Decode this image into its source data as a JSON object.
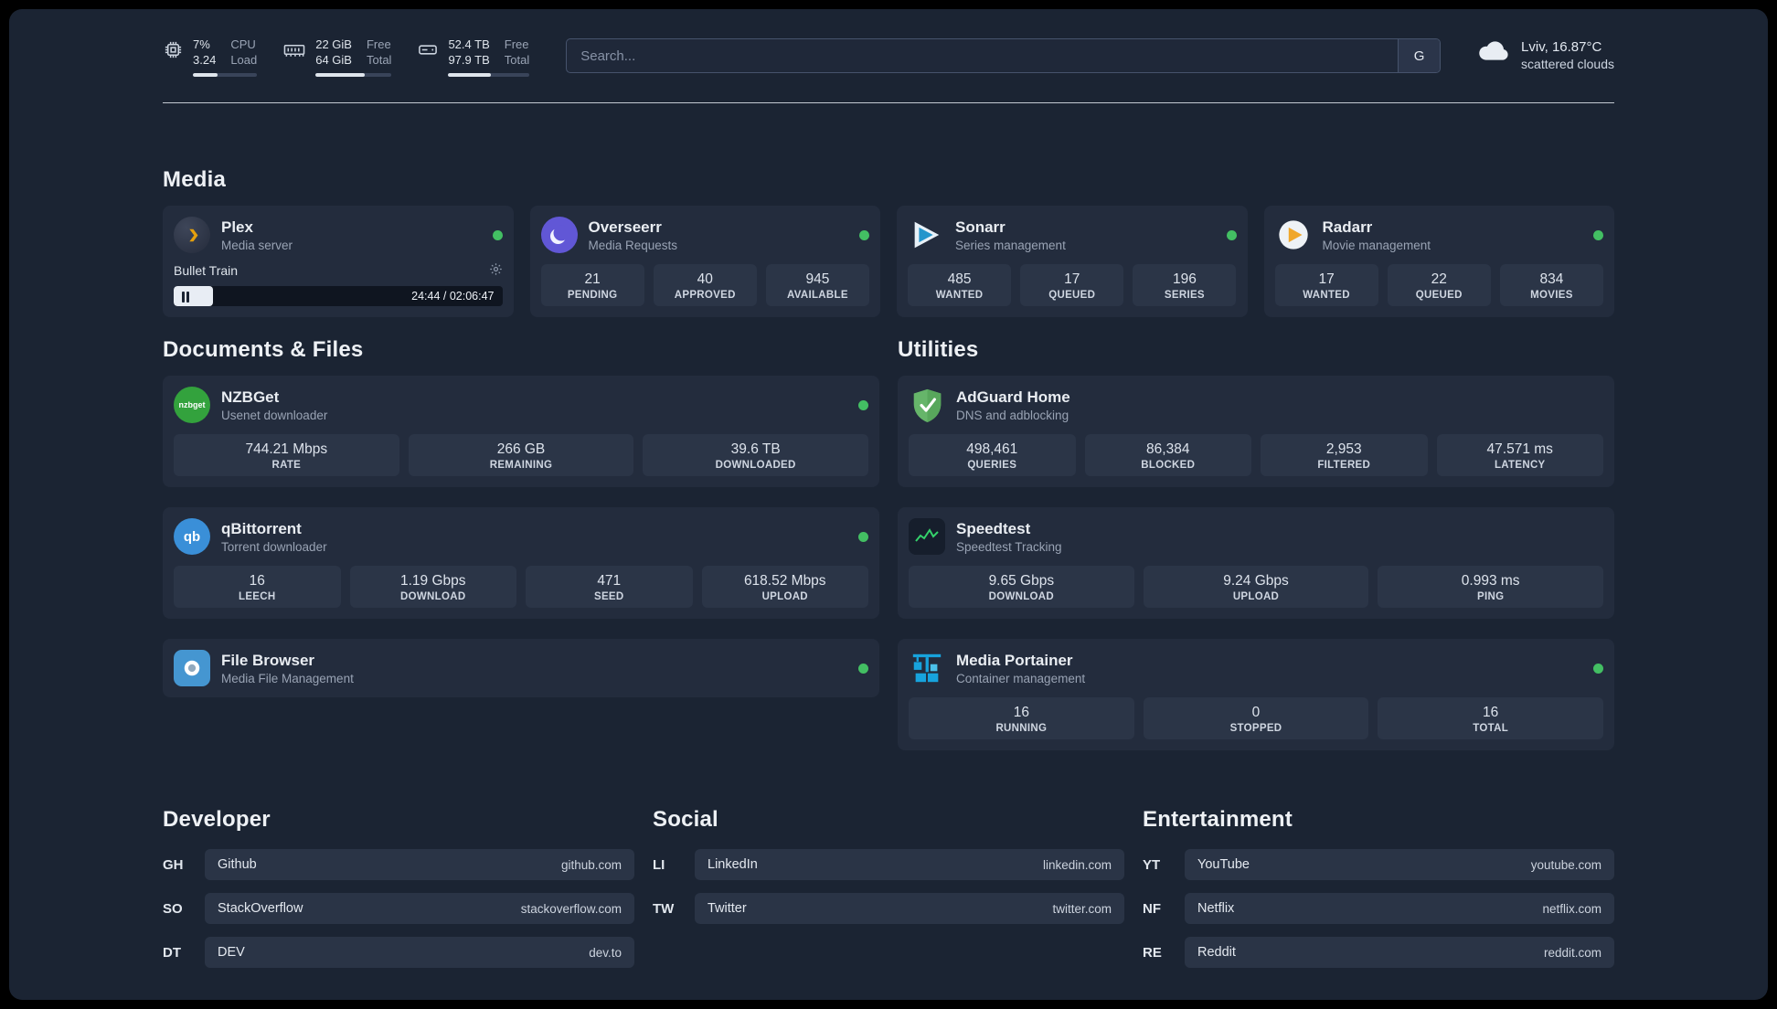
{
  "topbar": {
    "cpu": {
      "values": [
        "7%",
        "3.24"
      ],
      "labels": [
        "CPU",
        "Load"
      ],
      "progress_pct": 38
    },
    "ram": {
      "values": [
        "22 GiB",
        "64 GiB"
      ],
      "labels": [
        "Free",
        "Total"
      ],
      "progress_pct": 65
    },
    "disk": {
      "values": [
        "52.4 TB",
        "97.9 TB"
      ],
      "labels": [
        "Free",
        "Total"
      ],
      "progress_pct": 53
    },
    "search": {
      "placeholder": "Search...",
      "button_label": "G"
    },
    "weather": {
      "location": "Lviv, 16.87°C",
      "condition": "scattered clouds"
    }
  },
  "sections": {
    "media": {
      "title": "Media",
      "cards": [
        {
          "name": "Plex",
          "subtitle": "Media server",
          "status": "online",
          "now_playing": {
            "title": "Bullet Train",
            "time": "24:44 / 02:06:47",
            "progress_pct": 12
          }
        },
        {
          "name": "Overseerr",
          "subtitle": "Media Requests",
          "status": "online",
          "stats": [
            {
              "value": "21",
              "label": "PENDING"
            },
            {
              "value": "40",
              "label": "APPROVED"
            },
            {
              "value": "945",
              "label": "AVAILABLE"
            }
          ]
        },
        {
          "name": "Sonarr",
          "subtitle": "Series management",
          "status": "online",
          "stats": [
            {
              "value": "485",
              "label": "WANTED"
            },
            {
              "value": "17",
              "label": "QUEUED"
            },
            {
              "value": "196",
              "label": "SERIES"
            }
          ]
        },
        {
          "name": "Radarr",
          "subtitle": "Movie management",
          "status": "online",
          "stats": [
            {
              "value": "17",
              "label": "WANTED"
            },
            {
              "value": "22",
              "label": "QUEUED"
            },
            {
              "value": "834",
              "label": "MOVIES"
            }
          ]
        }
      ]
    },
    "documents": {
      "title": "Documents & Files",
      "cards": [
        {
          "name": "NZBGet",
          "subtitle": "Usenet downloader",
          "status": "online",
          "icon_text": "nzbget",
          "stats": [
            {
              "value": "744.21 Mbps",
              "label": "RATE"
            },
            {
              "value": "266 GB",
              "label": "REMAINING"
            },
            {
              "value": "39.6 TB",
              "label": "DOWNLOADED"
            }
          ]
        },
        {
          "name": "qBittorrent",
          "subtitle": "Torrent downloader",
          "status": "online",
          "icon_text": "qb",
          "stats": [
            {
              "value": "16",
              "label": "LEECH"
            },
            {
              "value": "1.19 Gbps",
              "label": "DOWNLOAD"
            },
            {
              "value": "471",
              "label": "SEED"
            },
            {
              "value": "618.52 Mbps",
              "label": "UPLOAD"
            }
          ]
        },
        {
          "name": "File Browser",
          "subtitle": "Media File Management",
          "status": "online"
        }
      ]
    },
    "utilities": {
      "title": "Utilities",
      "cards": [
        {
          "name": "AdGuard Home",
          "subtitle": "DNS and adblocking",
          "stats": [
            {
              "value": "498,461",
              "label": "QUERIES"
            },
            {
              "value": "86,384",
              "label": "BLOCKED"
            },
            {
              "value": "2,953",
              "label": "FILTERED"
            },
            {
              "value": "47.571 ms",
              "label": "LATENCY"
            }
          ]
        },
        {
          "name": "Speedtest",
          "subtitle": "Speedtest Tracking",
          "stats": [
            {
              "value": "9.65 Gbps",
              "label": "DOWNLOAD"
            },
            {
              "value": "9.24 Gbps",
              "label": "UPLOAD"
            },
            {
              "value": "0.993 ms",
              "label": "PING"
            }
          ]
        },
        {
          "name": "Media Portainer",
          "subtitle": "Container management",
          "status": "online",
          "stats": [
            {
              "value": "16",
              "label": "RUNNING"
            },
            {
              "value": "0",
              "label": "STOPPED"
            },
            {
              "value": "16",
              "label": "TOTAL"
            }
          ]
        }
      ]
    },
    "bookmarks": [
      {
        "title": "Developer",
        "items": [
          {
            "abbr": "GH",
            "name": "Github",
            "url": "github.com"
          },
          {
            "abbr": "SO",
            "name": "StackOverflow",
            "url": "stackoverflow.com"
          },
          {
            "abbr": "DT",
            "name": "DEV",
            "url": "dev.to"
          }
        ]
      },
      {
        "title": "Social",
        "items": [
          {
            "abbr": "LI",
            "name": "LinkedIn",
            "url": "linkedin.com"
          },
          {
            "abbr": "TW",
            "name": "Twitter",
            "url": "twitter.com"
          }
        ]
      },
      {
        "title": "Entertainment",
        "items": [
          {
            "abbr": "YT",
            "name": "YouTube",
            "url": "youtube.com"
          },
          {
            "abbr": "NF",
            "name": "Netflix",
            "url": "netflix.com"
          },
          {
            "abbr": "RE",
            "name": "Reddit",
            "url": "reddit.com"
          }
        ]
      }
    ]
  }
}
